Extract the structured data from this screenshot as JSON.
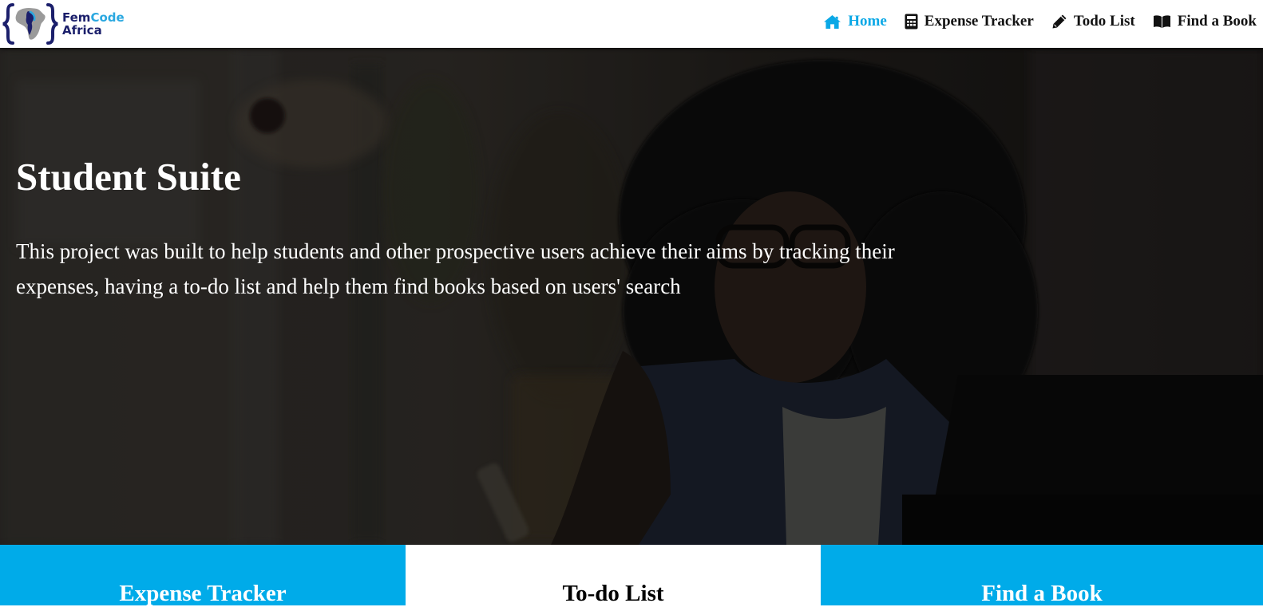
{
  "brand": {
    "line1_dark": "Fem",
    "line1_accent": "Code",
    "line2": "Africa",
    "colors": {
      "dark": "#1b1f6b",
      "accent": "#2ba8e0"
    }
  },
  "nav": {
    "items": [
      {
        "label": "Home",
        "icon": "home-icon",
        "active": true
      },
      {
        "label": "Expense Tracker",
        "icon": "calculator-icon",
        "active": false
      },
      {
        "label": "Todo List",
        "icon": "pencil-icon",
        "active": false
      },
      {
        "label": "Find a Book",
        "icon": "book-open-icon",
        "active": false
      }
    ],
    "active_color": "#0aa8e6"
  },
  "hero": {
    "title": "Student Suite",
    "description": "This project was built to help students and other prospective users achieve their aims by tracking their expenses, having a to-do list and help them find books based on users' search"
  },
  "cards": [
    {
      "title": "Expense Tracker",
      "background": "#00abe9"
    },
    {
      "title": "To-do List",
      "background": "#ffffff"
    },
    {
      "title": "Find a Book",
      "background": "#00abe9"
    }
  ]
}
